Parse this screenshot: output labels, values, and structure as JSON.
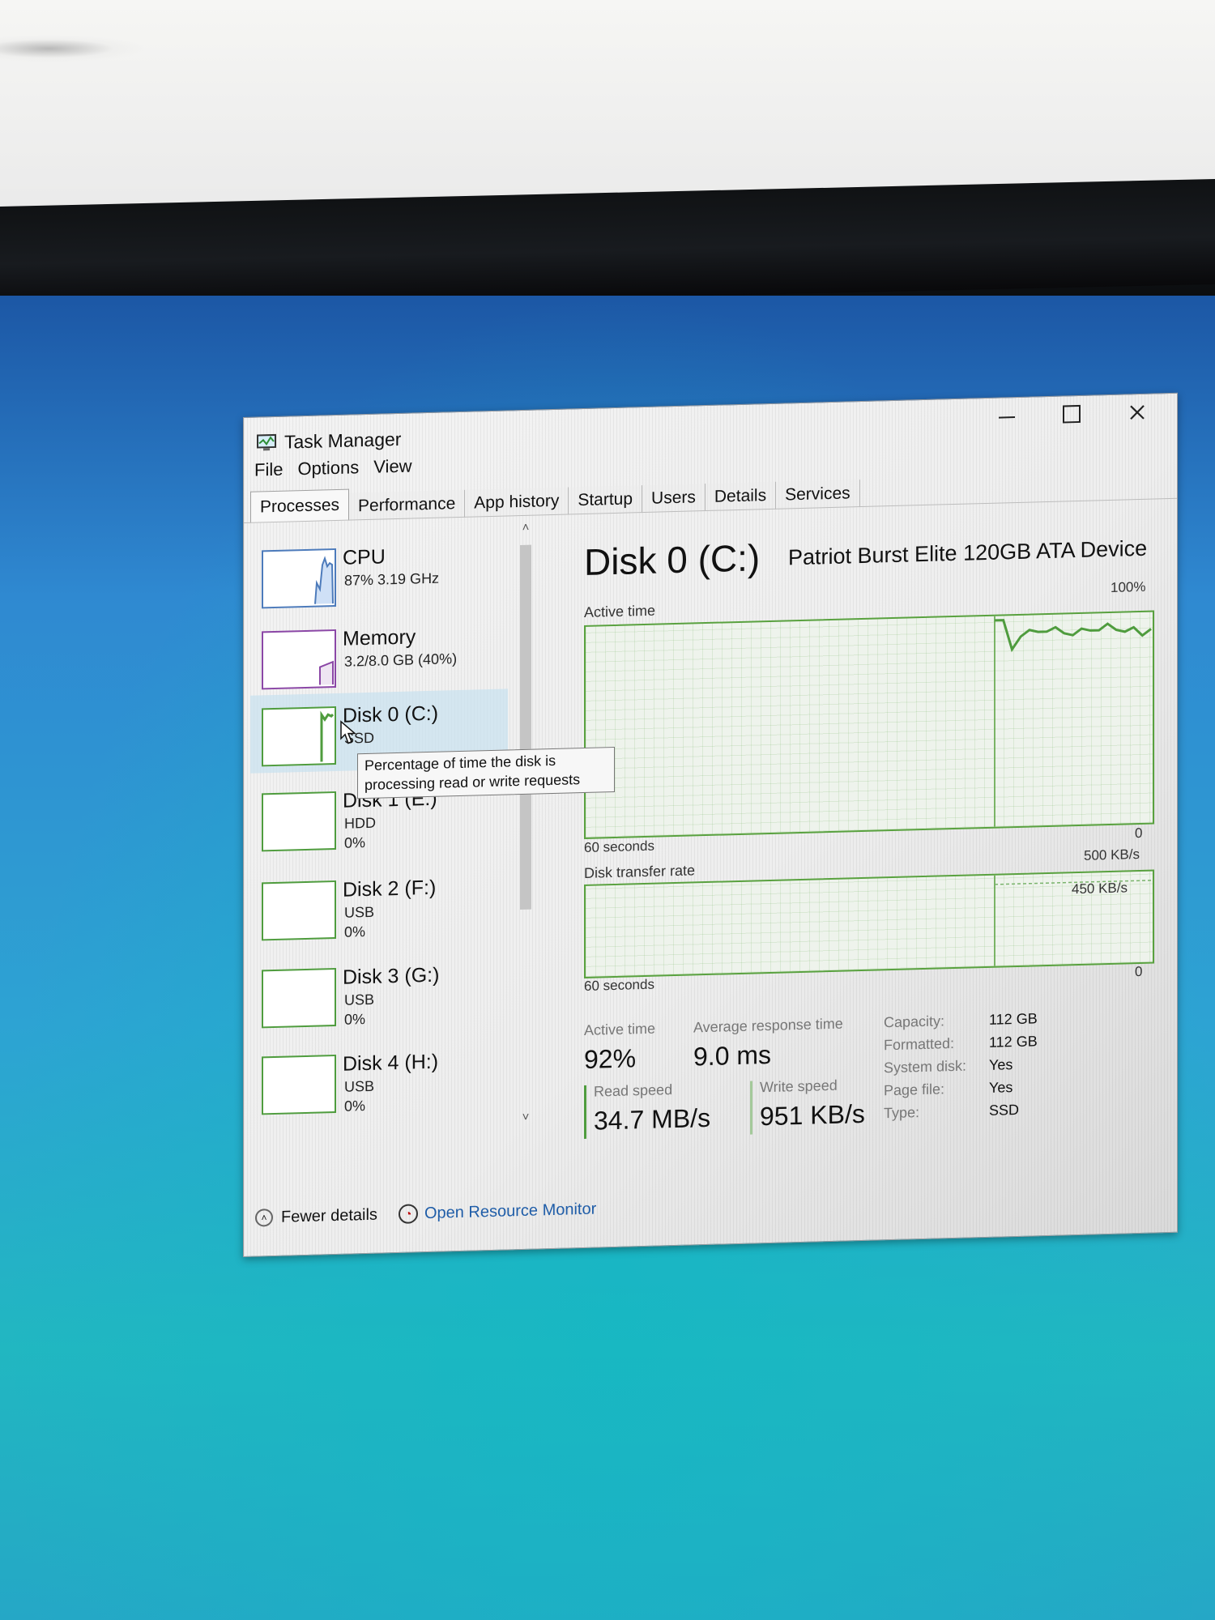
{
  "window": {
    "title": "Task Manager",
    "controls": {
      "minimize_icon": "minimize-icon",
      "maximize_icon": "maximize-icon",
      "close_icon": "close-icon"
    }
  },
  "menu": {
    "items": [
      "File",
      "Options",
      "View"
    ]
  },
  "tabs": [
    "Processes",
    "Performance",
    "App history",
    "Startup",
    "Users",
    "Details",
    "Services"
  ],
  "sidebar": {
    "items": [
      {
        "title": "CPU",
        "line1": "87% 3.19 GHz",
        "line2": "",
        "icon": "cpu-graph-icon"
      },
      {
        "title": "Memory",
        "line1": "3.2/8.0 GB (40%)",
        "line2": "",
        "icon": "memory-graph-icon"
      },
      {
        "title": "Disk 0 (C:)",
        "line1": "SSD",
        "line2": "",
        "icon": "disk-graph-icon"
      },
      {
        "title": "Disk 1 (E:)",
        "line1": "HDD",
        "line2": "0%",
        "icon": "disk-graph-icon"
      },
      {
        "title": "Disk 2 (F:)",
        "line1": "USB",
        "line2": "0%",
        "icon": "disk-graph-icon"
      },
      {
        "title": "Disk 3 (G:)",
        "line1": "USB",
        "line2": "0%",
        "icon": "disk-graph-icon"
      },
      {
        "title": "Disk 4 (H:)",
        "line1": "USB",
        "line2": "0%",
        "icon": "disk-graph-icon"
      }
    ],
    "tooltip": {
      "line1": "Percentage of time the disk is",
      "line2": "processing read or write requests"
    }
  },
  "details": {
    "title": "Disk 0 (C:)",
    "model": "Patriot Burst Elite 120GB ATA Device",
    "active_graph": {
      "label": "Active time",
      "max_label": "100%",
      "min_label": "0",
      "time_label": "60 seconds",
      "recent_percentages": [
        98,
        98,
        84,
        90,
        93,
        92,
        92,
        94,
        91,
        90,
        93,
        92,
        92,
        95,
        92,
        91,
        93,
        89,
        92
      ]
    },
    "transfer_graph": {
      "label": "Disk transfer rate",
      "max_label": "500 KB/s",
      "marker_label": "450 KB/s",
      "min_label": "0",
      "time_label": "60 seconds",
      "marker_value": 450,
      "max_value": 500
    },
    "stats": {
      "active_time_label": "Active time",
      "active_time": "92%",
      "response_label": "Average response time",
      "response_time": "9.0 ms",
      "read_label": "Read speed",
      "read_speed": "34.7 MB/s",
      "write_label": "Write speed",
      "write_speed": "951 KB/s"
    },
    "properties": [
      {
        "label": "Capacity:",
        "value": "112 GB"
      },
      {
        "label": "Formatted:",
        "value": "112 GB"
      },
      {
        "label": "System disk:",
        "value": "Yes"
      },
      {
        "label": "Page file:",
        "value": "Yes"
      },
      {
        "label": "Type:",
        "value": "SSD"
      }
    ]
  },
  "footer": {
    "fewer_details": "Fewer details",
    "open_resource_monitor": "Open Resource Monitor",
    "fewer_icon": "chevron-up-circle-icon",
    "resource_icon": "resource-monitor-icon"
  },
  "colors": {
    "cpu": "#4d7bbb",
    "memory": "#8b47a6",
    "disk": "#4f9c3e",
    "link": "#1f5da8",
    "speed_read": "#4f9c3e",
    "speed_write": "#a4c99a"
  }
}
